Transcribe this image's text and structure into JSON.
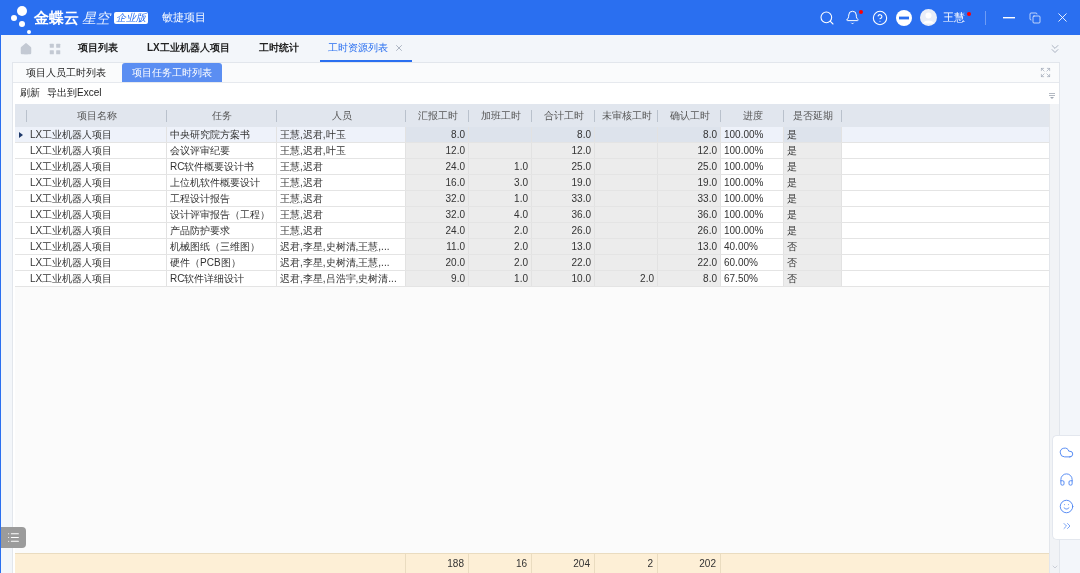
{
  "header": {
    "logo": {
      "brand": "金蝶云",
      "product": "星空",
      "edition": "企业版"
    },
    "module": "敏捷项目",
    "notifications": {
      "unread": true
    },
    "user": {
      "name": "王慧",
      "unread": true
    }
  },
  "tabs": [
    {
      "label": "项目列表",
      "selected": false,
      "closable": false
    },
    {
      "label": "LX工业机器人项目",
      "selected": false,
      "closable": false
    },
    {
      "label": "工时统计",
      "selected": false,
      "closable": false
    },
    {
      "label": "工时资源列表",
      "selected": true,
      "closable": true
    }
  ],
  "subtabs": [
    {
      "label": "项目人员工时列表",
      "selected": false
    },
    {
      "label": "项目任务工时列表",
      "selected": true
    }
  ],
  "toolbar": [
    "刷新",
    "导出到Excel"
  ],
  "table": {
    "columns": [
      {
        "label": "项目名称",
        "kind": "text",
        "locked": false
      },
      {
        "label": "任务",
        "kind": "text",
        "locked": false
      },
      {
        "label": "人员",
        "kind": "text",
        "locked": false
      },
      {
        "label": "汇报工时",
        "kind": "number",
        "locked": true
      },
      {
        "label": "加班工时",
        "kind": "number",
        "locked": true
      },
      {
        "label": "合计工时",
        "kind": "number",
        "locked": true
      },
      {
        "label": "未审核工时",
        "kind": "number",
        "locked": true
      },
      {
        "label": "确认工时",
        "kind": "number",
        "locked": true
      },
      {
        "label": "进度",
        "kind": "text",
        "locked": false
      },
      {
        "label": "是否延期",
        "kind": "text",
        "locked": true
      }
    ],
    "rows": [
      {
        "selected": true,
        "cells": [
          "LX工业机器人项目",
          "中央研究院方案书",
          "王慧,迟君,叶玉",
          "8.0",
          null,
          "8.0",
          null,
          "8.0",
          "100.00%",
          "是"
        ]
      },
      {
        "selected": false,
        "cells": [
          "LX工业机器人项目",
          "会议评审纪要",
          "王慧,迟君,叶玉",
          "12.0",
          null,
          "12.0",
          null,
          "12.0",
          "100.00%",
          "是"
        ]
      },
      {
        "selected": false,
        "cells": [
          "LX工业机器人项目",
          "RC软件概要设计书",
          "王慧,迟君",
          "24.0",
          "1.0",
          "25.0",
          null,
          "25.0",
          "100.00%",
          "是"
        ]
      },
      {
        "selected": false,
        "cells": [
          "LX工业机器人项目",
          "上位机软件概要设计",
          "王慧,迟君",
          "16.0",
          "3.0",
          "19.0",
          null,
          "19.0",
          "100.00%",
          "是"
        ]
      },
      {
        "selected": false,
        "cells": [
          "LX工业机器人项目",
          "工程设计报告",
          "王慧,迟君",
          "32.0",
          "1.0",
          "33.0",
          null,
          "33.0",
          "100.00%",
          "是"
        ]
      },
      {
        "selected": false,
        "cells": [
          "LX工业机器人项目",
          "设计评审报告（工程）",
          "王慧,迟君",
          "32.0",
          "4.0",
          "36.0",
          null,
          "36.0",
          "100.00%",
          "是"
        ]
      },
      {
        "selected": false,
        "cells": [
          "LX工业机器人项目",
          "产品防护要求",
          "王慧,迟君",
          "24.0",
          "2.0",
          "26.0",
          null,
          "26.0",
          "100.00%",
          "是"
        ]
      },
      {
        "selected": false,
        "cells": [
          "LX工业机器人项目",
          "机械图纸（三维图）",
          "迟君,李星,史树清,王慧,...",
          "11.0",
          "2.0",
          "13.0",
          null,
          "13.0",
          "40.00%",
          "否"
        ]
      },
      {
        "selected": false,
        "cells": [
          "LX工业机器人项目",
          "硬件（PCB图）",
          "迟君,李星,史树清,王慧,...",
          "20.0",
          "2.0",
          "22.0",
          null,
          "22.0",
          "60.00%",
          "否"
        ]
      },
      {
        "selected": false,
        "cells": [
          "LX工业机器人项目",
          "RC软件详细设计",
          "迟君,李星,吕浩宇,史树清...",
          "9.0",
          "1.0",
          "10.0",
          "2.0",
          "8.0",
          "67.50%",
          "否"
        ]
      }
    ],
    "totals": [
      "188",
      "16",
      "204",
      "2",
      "202"
    ]
  }
}
